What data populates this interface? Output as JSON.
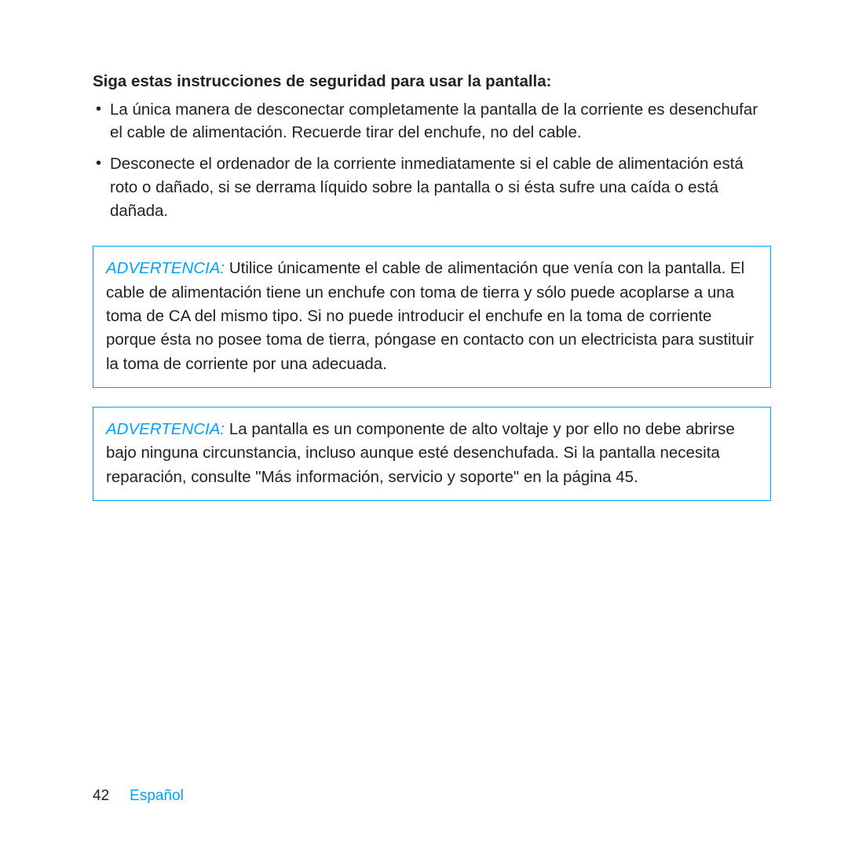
{
  "heading": "Siga estas instrucciones de seguridad para usar la pantalla:",
  "bullets": [
    "La única manera de desconectar completamente la pantalla de la corriente es desenchufar el cable de alimentación. Recuerde tirar del enchufe, no del cable.",
    "Desconecte el ordenador de la corriente inmediatamente si el cable de alimentación está roto o dañado, si se derrama líquido sobre la pantalla o si ésta sufre una caída o está dañada."
  ],
  "warnings": [
    {
      "label": "ADVERTENCIA:",
      "text": "  Utilice únicamente el cable de alimentación que venía con la pantalla. El cable de alimentación tiene un enchufe con toma de tierra y sólo puede acoplarse a una toma de CA del mismo tipo. Si no puede introducir el enchufe en la toma de corriente porque ésta no posee toma de tierra, póngase en contacto con un electricista para sustituir la toma de corriente por una adecuada."
    },
    {
      "label": "ADVERTENCIA:",
      "text": "  La pantalla es un componente de alto voltaje y por ello no debe abrirse bajo ninguna circunstancia, incluso aunque esté desenchufada. Si la pantalla necesita reparación, consulte \"Más información, servicio y soporte\" en la página 45."
    }
  ],
  "footer": {
    "page": "42",
    "language": "Español"
  }
}
